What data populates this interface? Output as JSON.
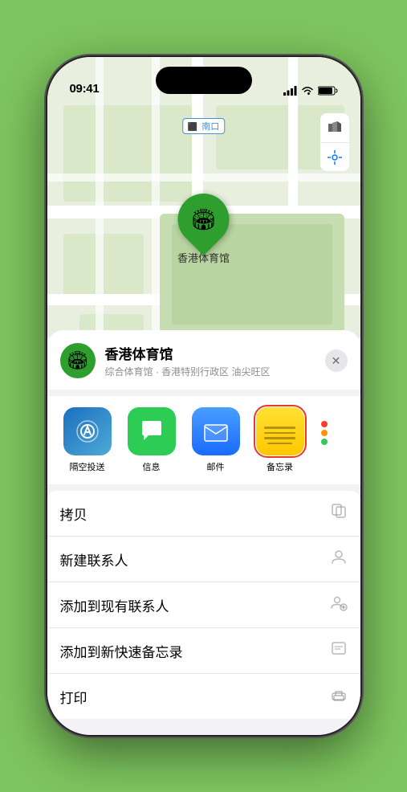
{
  "status_bar": {
    "time": "09:41",
    "location_icon": "▶"
  },
  "map": {
    "label": "南口",
    "pin_emoji": "🏟",
    "pin_label": "香港体育馆"
  },
  "location_header": {
    "icon_emoji": "🏟",
    "name": "香港体育馆",
    "subtitle": "综合体育馆 · 香港特别行政区 油尖旺区",
    "close_label": "✕"
  },
  "apps": [
    {
      "id": "airdrop",
      "label": "隔空投送"
    },
    {
      "id": "messages",
      "label": "信息"
    },
    {
      "id": "mail",
      "label": "邮件"
    },
    {
      "id": "notes",
      "label": "备忘录"
    }
  ],
  "actions": [
    {
      "id": "copy",
      "label": "拷贝",
      "icon": "⧉"
    },
    {
      "id": "new-contact",
      "label": "新建联系人",
      "icon": "👤"
    },
    {
      "id": "add-existing",
      "label": "添加到现有联系人",
      "icon": "👤"
    },
    {
      "id": "add-note",
      "label": "添加到新快速备忘录",
      "icon": "📋"
    },
    {
      "id": "print",
      "label": "打印",
      "icon": "🖨"
    }
  ]
}
